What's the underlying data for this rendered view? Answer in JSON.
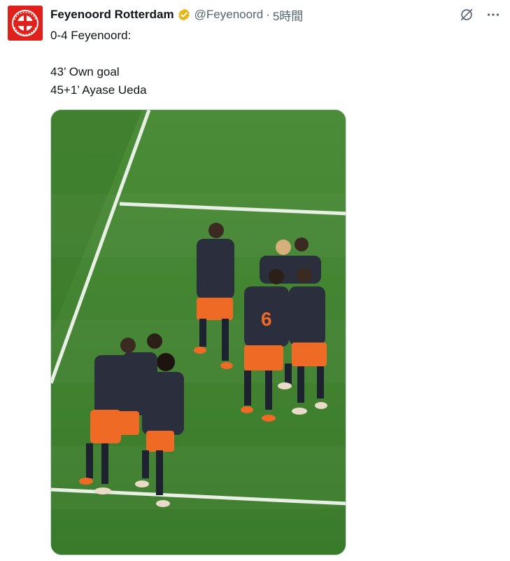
{
  "tweet": {
    "author_name": "Feyenoord Rotterdam",
    "handle": "@Feyenoord",
    "separator": "·",
    "time": "5時間",
    "text_lines": [
      "0-4 Feyenoord:",
      "43’ Own goal",
      "45+1’ Ayase Ueda"
    ],
    "avatar_icon": "feyenoord-crest-icon",
    "verified_icon": "gold-verified-badge-icon"
  },
  "actions": {
    "grok_icon": "grok-icon",
    "more_icon": "more-icon"
  },
  "media": {
    "alt": "Feyenoord players celebrating a goal on the pitch",
    "jersey_number": "6"
  },
  "colors": {
    "brand_red": "#e0211b",
    "verified_gold": "#e2b719",
    "pitch_green": "#3e7f2e",
    "kit_orange": "#ef6a24",
    "kit_navy": "#2b2f3d"
  }
}
